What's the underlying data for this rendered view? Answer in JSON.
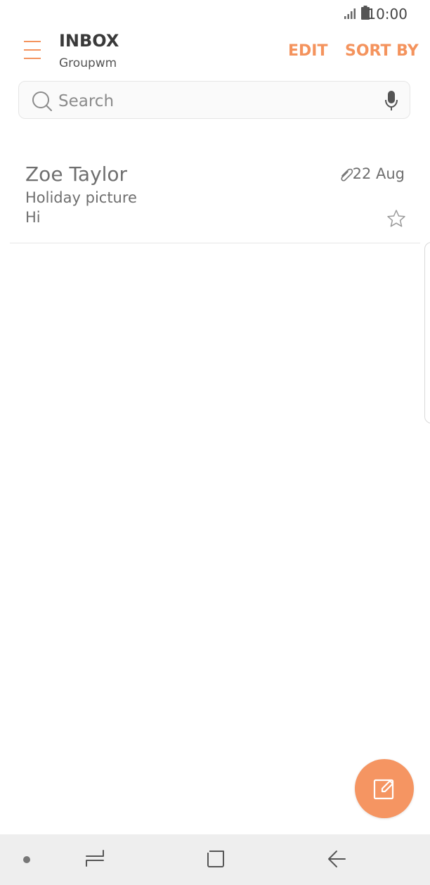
{
  "status_bar": {
    "time": "10:00",
    "icons": [
      "signal-icon",
      "battery-icon"
    ]
  },
  "header": {
    "title": "INBOX",
    "account": "Groupwm",
    "actions": {
      "edit_label": "EDIT",
      "sort_label": "SORT BY"
    }
  },
  "search": {
    "placeholder": "Search",
    "value": ""
  },
  "emails": [
    {
      "sender": "Zoe Taylor",
      "subject": "Holiday picture",
      "preview": "Hi",
      "date": "22 Aug",
      "has_attachment": true,
      "starred": false
    }
  ],
  "colors": {
    "accent": "#f4935d",
    "fab": "#f59562",
    "text_secondary": "#6f6f6f",
    "nav_bar": "#eeeeee"
  }
}
